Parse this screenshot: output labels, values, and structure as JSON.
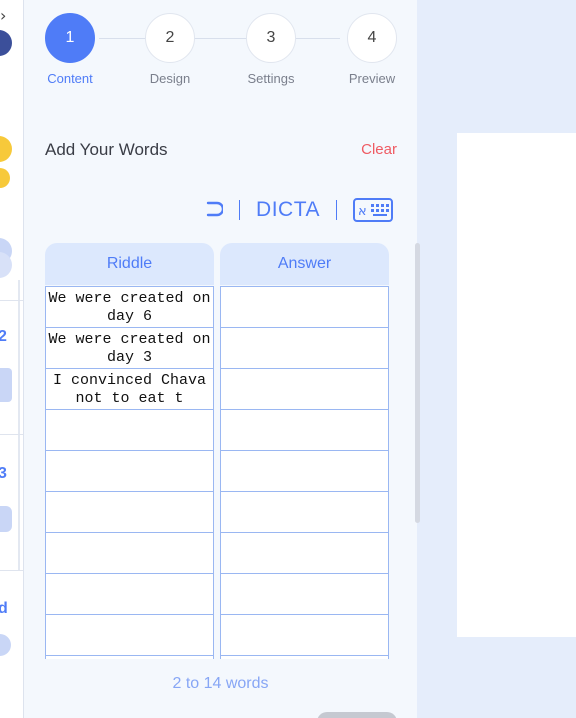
{
  "stepper": {
    "steps": [
      {
        "number": "1",
        "label": "Content"
      },
      {
        "number": "2",
        "label": "Design"
      },
      {
        "number": "3",
        "label": "Settings"
      },
      {
        "number": "4",
        "label": "Preview"
      }
    ],
    "active_step": "1"
  },
  "sidebar": {
    "numbers": [
      "2",
      "3",
      "d"
    ]
  },
  "content": {
    "section_title": "Add Your Words",
    "clear_label": "Clear",
    "toolbar": {
      "brand_label": "DICTA",
      "icons": [
        "undo-icon",
        "hebrew-keyboard-icon"
      ]
    },
    "table": {
      "headers": [
        "Riddle",
        "Answer"
      ],
      "riddles": [
        "We were created on day 6",
        "We were created on day 3",
        "I convinced Chava not to eat t",
        "",
        "",
        "",
        "",
        "",
        ""
      ],
      "answers": [
        "",
        "",
        "",
        "",
        "",
        "",
        "",
        "",
        ""
      ]
    },
    "word_hint": "2 to 14 words"
  },
  "colors": {
    "accent": "#4f7cf7",
    "danger": "#ef5b63",
    "panel_bg": "#f4f8fd",
    "page_bg": "#e5edfb"
  }
}
